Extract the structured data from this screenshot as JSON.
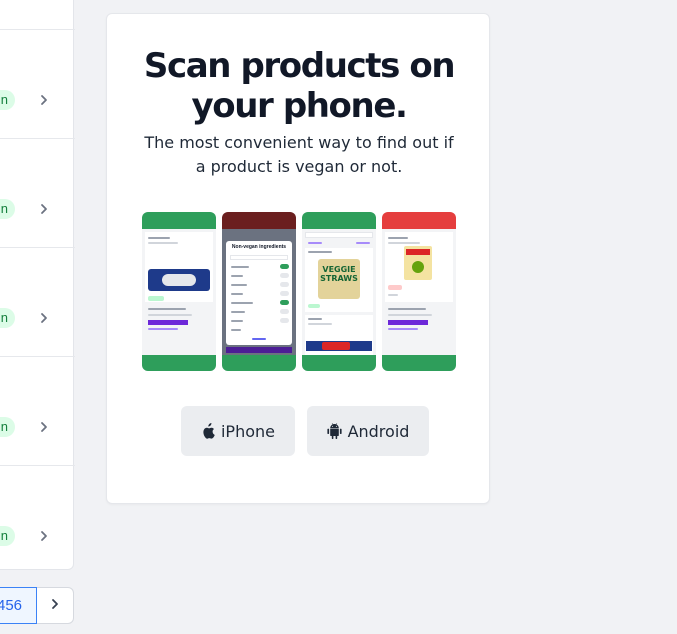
{
  "list": {
    "badge_text": "n",
    "rows": [
      {
        "badge": "n"
      },
      {
        "badge": "n"
      },
      {
        "badge": "n"
      },
      {
        "badge": "n"
      },
      {
        "badge": "n"
      }
    ]
  },
  "pagination": {
    "current_page": "456",
    "next_icon": "chevron-right-icon"
  },
  "promo": {
    "title": "Scan products on your phone.",
    "subtitle": "The most convenient way to find out if a product is vegan or not.",
    "screens": [
      {
        "name": "product-screen-oreo",
        "header_color": "#2e9e5b"
      },
      {
        "name": "non-vegan-ingredients-screen",
        "header_color": "#6b1f1f",
        "dialog_title": "Non-vegan ingredients"
      },
      {
        "name": "search-screen-veggie-straws",
        "header_color": "#2e9e5b",
        "product": "VEGGIE STRAWS"
      },
      {
        "name": "product-screen-bearnaise",
        "header_color": "#e53e3e"
      }
    ],
    "buttons": {
      "iphone": {
        "label": "iPhone",
        "icon": "apple-icon"
      },
      "android": {
        "label": "Android",
        "icon": "android-icon"
      }
    }
  },
  "colors": {
    "accent_green": "#2e9e5b",
    "accent_red": "#e53e3e",
    "badge_bg": "#dcfce7",
    "badge_text": "#15803d",
    "link_blue": "#2563eb"
  }
}
